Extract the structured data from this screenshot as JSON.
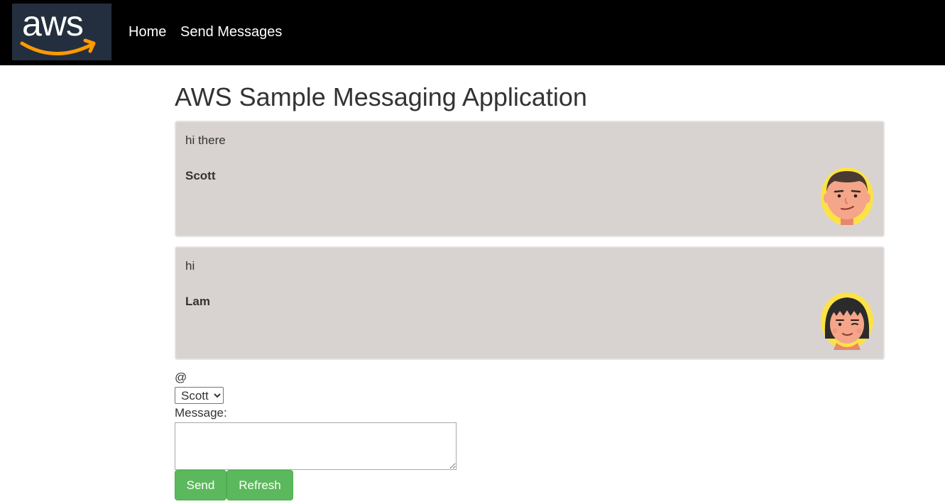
{
  "header": {
    "logo_text": "aws",
    "nav": [
      {
        "label": "Home"
      },
      {
        "label": "Send Messages"
      }
    ]
  },
  "main": {
    "title": "AWS Sample Messaging Application",
    "messages": [
      {
        "text": "hi there",
        "author": "Scott",
        "avatar_icon": "male-avatar-icon"
      },
      {
        "text": "hi",
        "author": "Lam",
        "avatar_icon": "female-avatar-icon"
      }
    ]
  },
  "form": {
    "at_label": "@",
    "recipient_selected": "Scott",
    "message_label": "Message:",
    "message_value": "",
    "send_label": "Send",
    "refresh_label": "Refresh"
  },
  "colors": {
    "topbar": "#000000",
    "logo_bg": "#232f3e",
    "logo_smile": "#ff9900",
    "card_bg": "#d8d3d1",
    "button_green": "#5cb85c"
  }
}
